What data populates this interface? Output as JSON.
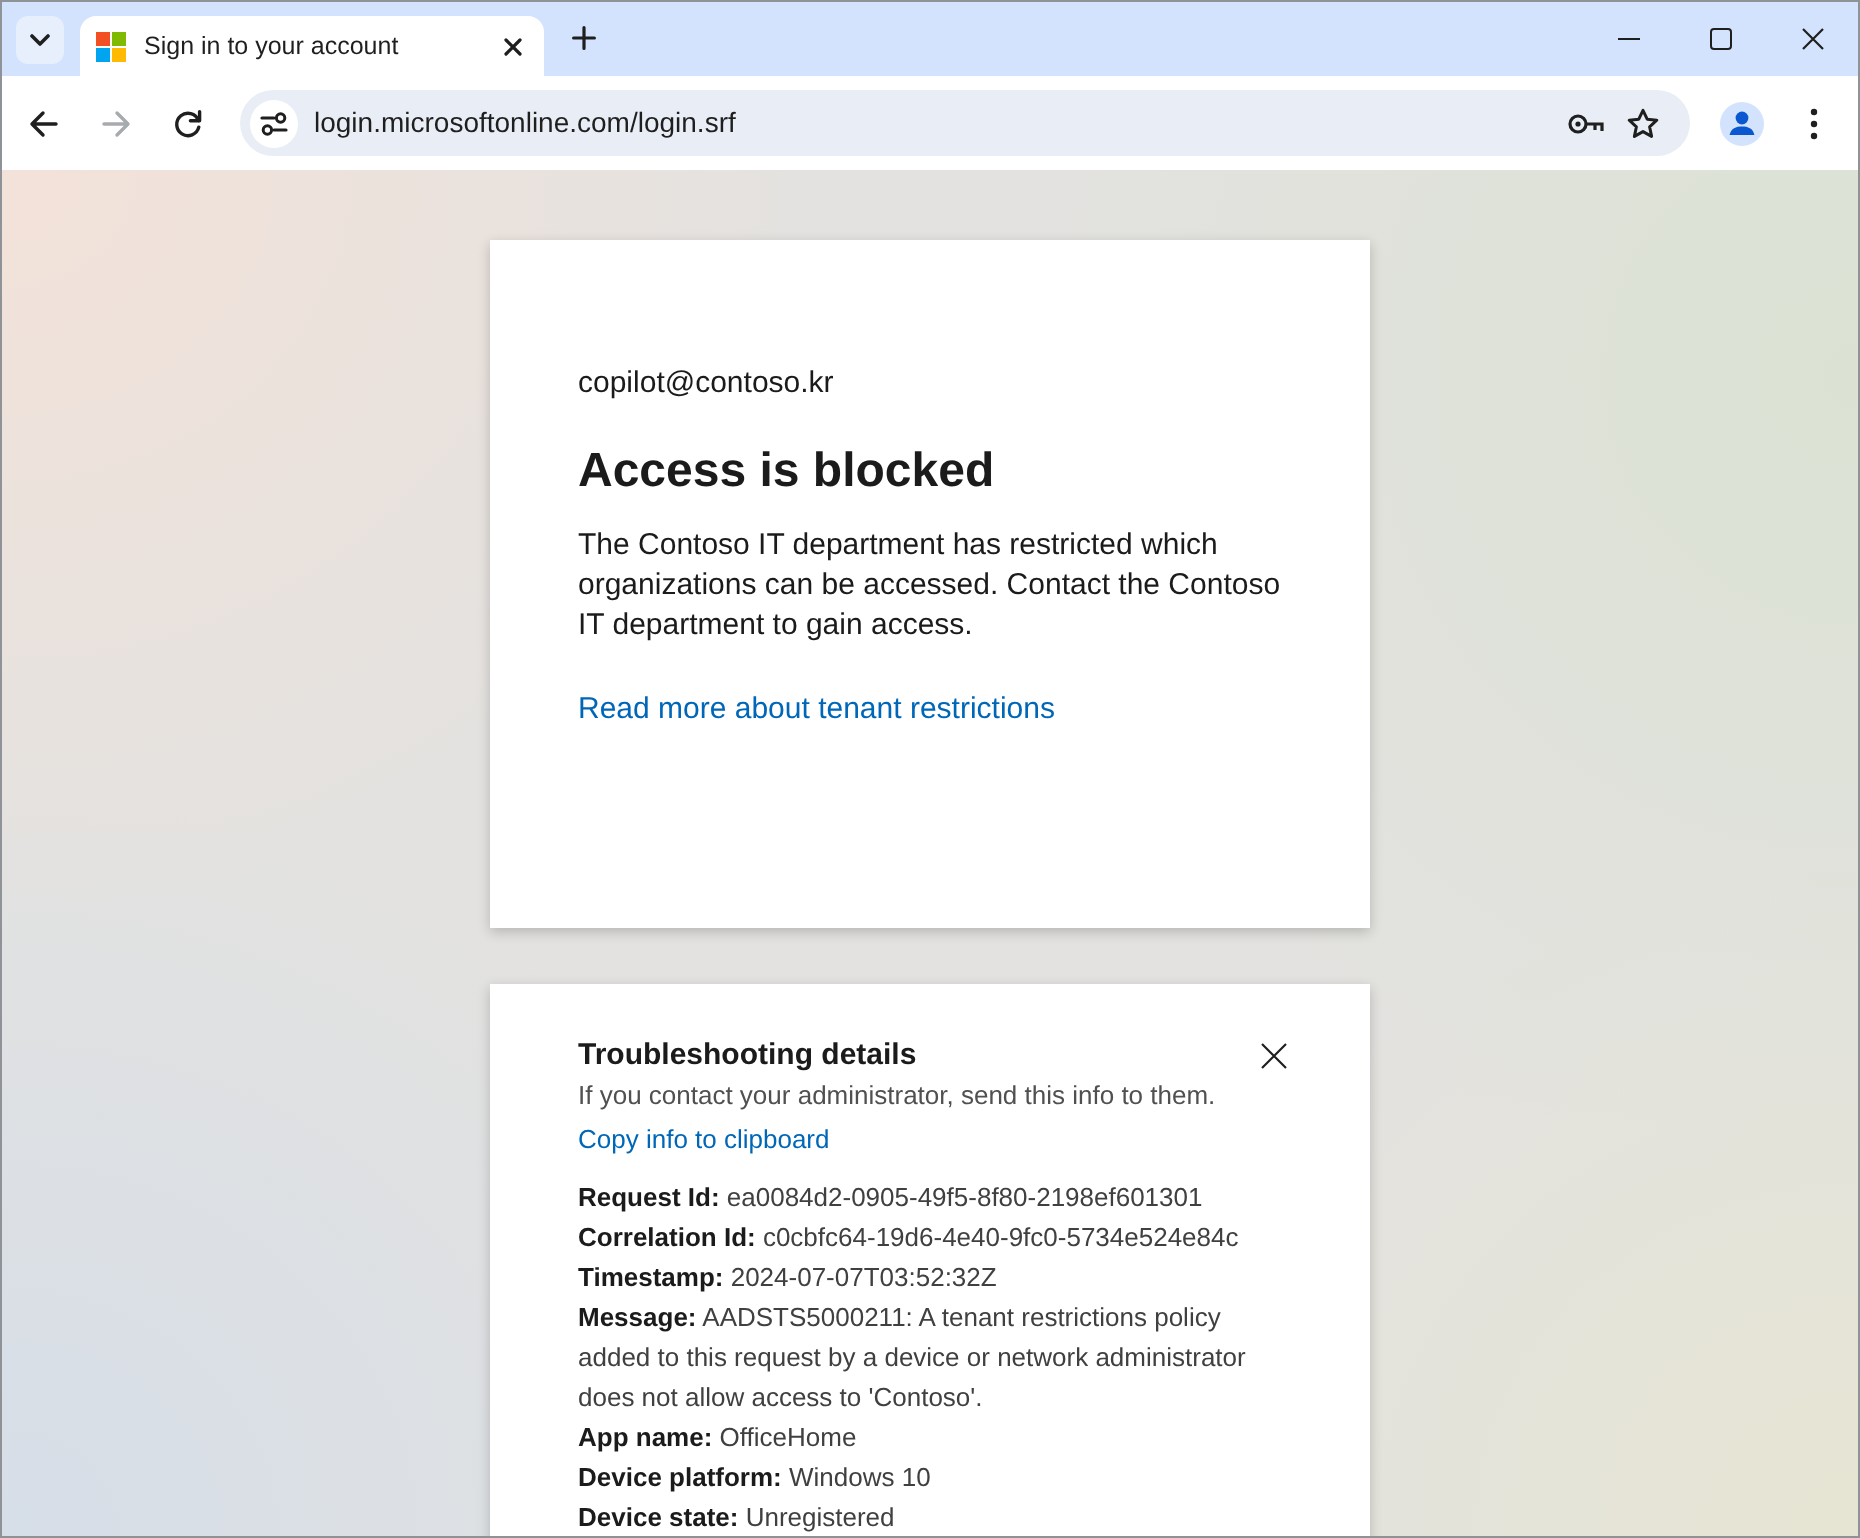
{
  "window": {
    "tabs": [
      {
        "title": "Sign in to your account",
        "selected": true
      }
    ]
  },
  "toolbar": {
    "nav_buttons": [
      {
        "kind": "back",
        "disabled": false
      },
      {
        "kind": "forward",
        "disabled": true
      },
      {
        "kind": "reload",
        "disabled": false
      }
    ],
    "address": "login.microsoftonline.com/login.srf"
  },
  "sign_in_card": {
    "account": "copilot@contoso.kr",
    "heading": "Access is blocked",
    "message": "The Contoso IT department has restricted which organizations can be accessed. Contact the Contoso IT department to gain access.",
    "link": "Read more about tenant restrictions"
  },
  "troubleshooting": {
    "title": "Troubleshooting details",
    "subtitle": "If you contact your administrator, send this info to them.",
    "copy_link": "Copy info to clipboard",
    "details": [
      "**Request Id:** ea0084d2-0905-49f5-8f80-2198ef601301",
      "**Correlation Id:** c0cbfc64-19d6-4e40-9fc0-5734e524e84c",
      "**Timestamp:** 2024-07-07T03:52:32Z",
      "**Message:** AADSTS5000211: A tenant restrictions policy added to this request by a device or network administrator does not allow access to 'Contoso'.",
      "**App name:** OfficeHome",
      "**Device platform:** Windows 10",
      "**Device state:** Unregistered"
    ]
  }
}
